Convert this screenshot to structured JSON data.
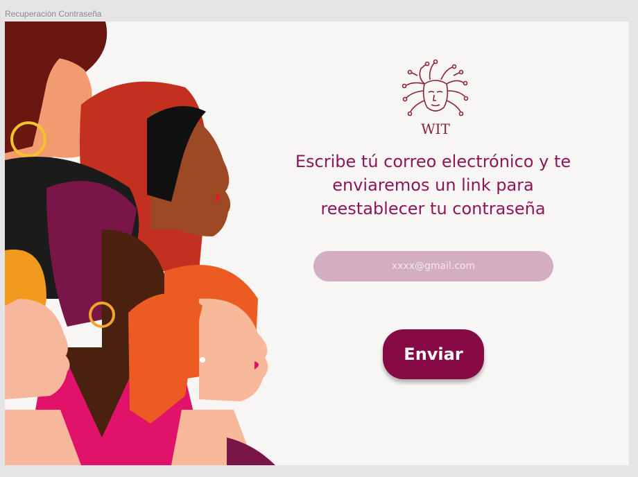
{
  "frame": {
    "title": "Recuperación Contraseña"
  },
  "logo": {
    "icon": "medusa-circuit-logo-icon",
    "text": "WIT",
    "color": "#8b2233"
  },
  "headline": {
    "line1": "Escribe tú correo electrónico y te",
    "line2": "enviaremos un link para",
    "line3": "reestablecer tu contraseña"
  },
  "email_input": {
    "value": "",
    "placeholder": "xxxx@gmail.com"
  },
  "submit_button": {
    "label": "Enviar"
  },
  "colors": {
    "brand": "#860a43",
    "headline": "#8e1657",
    "input_bg": "#d3adc0",
    "panel_bg": "#f8f6f5"
  },
  "illustration": {
    "icon": "diverse-women-profiles-illustration"
  }
}
